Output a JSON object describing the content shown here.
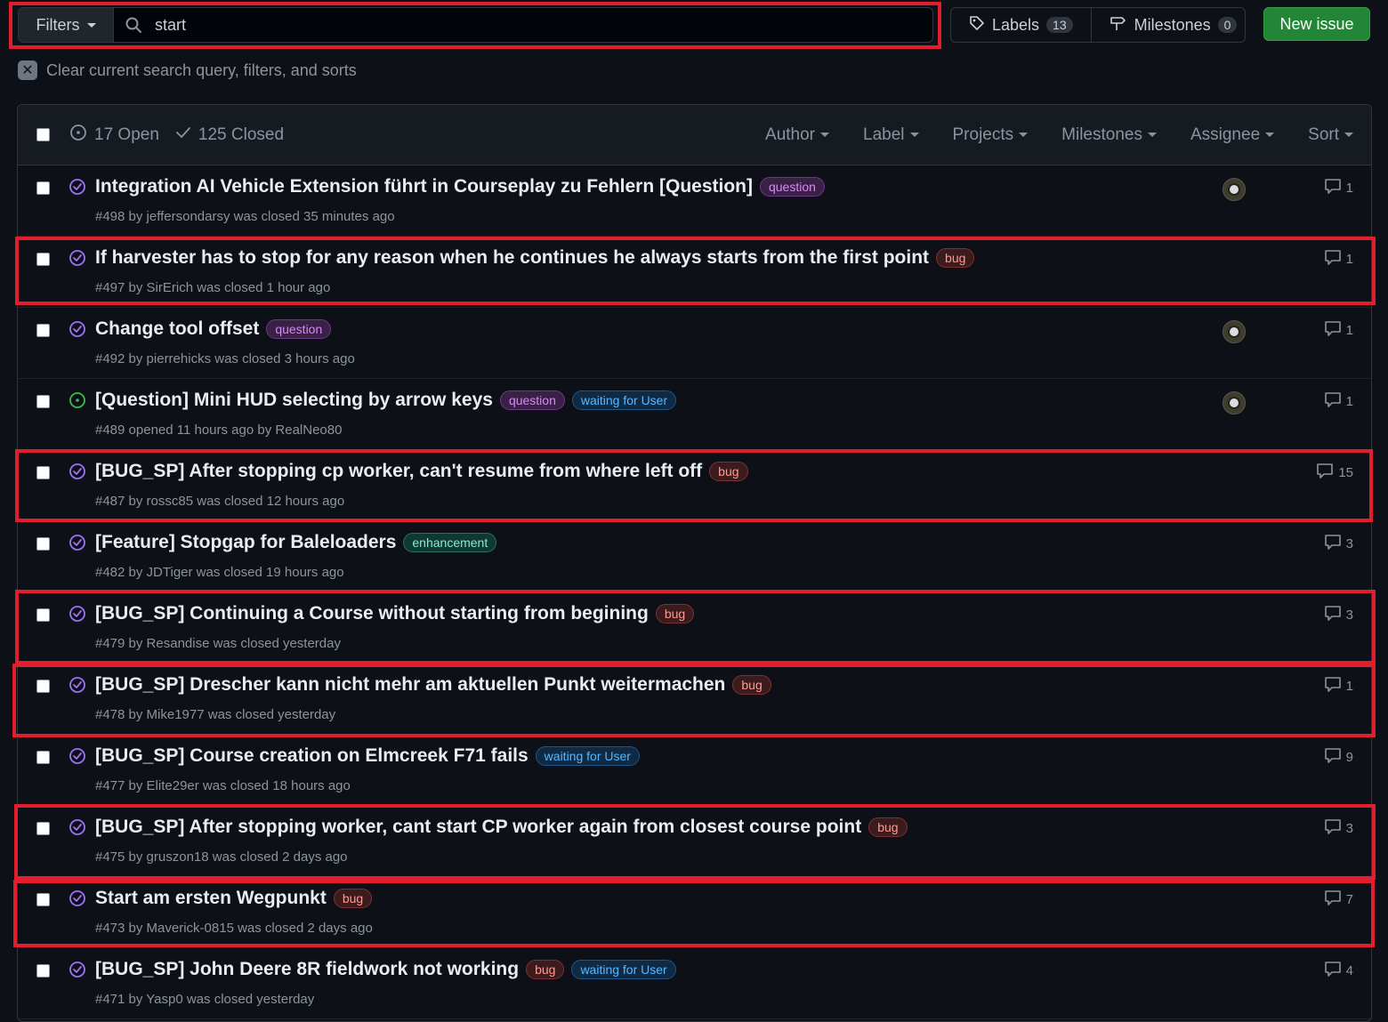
{
  "toolbar": {
    "filters_label": "Filters",
    "search_value": "start",
    "labels_label": "Labels",
    "labels_count": "13",
    "milestones_label": "Milestones",
    "milestones_count": "0",
    "new_issue_label": "New issue"
  },
  "clear_query": "Clear current search query, filters, and sorts",
  "list_header": {
    "open": "17 Open",
    "closed": "125 Closed",
    "menus": [
      "Author",
      "Label",
      "Projects",
      "Milestones",
      "Assignee",
      "Sort"
    ]
  },
  "issues": [
    {
      "title": "Integration AI Vehicle Extension führt in Courseplay zu Fehlern [Question]",
      "labels": [
        "question"
      ],
      "meta": "#498 by jeffersondarsy was closed 35 minutes ago",
      "comments": "1",
      "state": "closed",
      "avatar": true
    },
    {
      "title": "If harvester has to stop for any reason when he continues he always starts from the first point",
      "labels": [
        "bug"
      ],
      "meta": "#497 by SirErich was closed 1 hour ago",
      "comments": "1",
      "state": "closed",
      "avatar": false
    },
    {
      "title": "Change tool offset",
      "labels": [
        "question"
      ],
      "meta": "#492 by pierrehicks was closed 3 hours ago",
      "comments": "1",
      "state": "closed",
      "avatar": true
    },
    {
      "title": "[Question] Mini HUD selecting by arrow keys",
      "labels": [
        "question",
        "waiting for User"
      ],
      "meta": "#489 opened 11 hours ago by RealNeo80",
      "comments": "1",
      "state": "open",
      "avatar": true
    },
    {
      "title": "[BUG_SP] After stopping cp worker, can't resume from where left off",
      "labels": [
        "bug"
      ],
      "meta": "#487 by rossc85 was closed 12 hours ago",
      "comments": "15",
      "state": "closed",
      "avatar": false
    },
    {
      "title": "[Feature] Stopgap for Baleloaders",
      "labels": [
        "enhancement"
      ],
      "meta": "#482 by JDTiger was closed 19 hours ago",
      "comments": "3",
      "state": "closed",
      "avatar": false
    },
    {
      "title": "[BUG_SP] Continuing a Course without starting from begining",
      "labels": [
        "bug"
      ],
      "meta": "#479 by Resandise was closed yesterday",
      "comments": "3",
      "state": "closed",
      "avatar": false
    },
    {
      "title": "[BUG_SP] Drescher kann nicht mehr am aktuellen Punkt weitermachen",
      "labels": [
        "bug"
      ],
      "meta": "#478 by Mike1977 was closed yesterday",
      "comments": "1",
      "state": "closed",
      "avatar": false
    },
    {
      "title": "[BUG_SP] Course creation on Elmcreek F71 fails",
      "labels": [
        "waiting for User"
      ],
      "meta": "#477 by Elite29er was closed 18 hours ago",
      "comments": "9",
      "state": "closed",
      "avatar": false
    },
    {
      "title": "[BUG_SP] After stopping worker, cant start CP worker again from closest course point",
      "labels": [
        "bug"
      ],
      "meta": "#475 by gruszon18 was closed 2 days ago",
      "comments": "3",
      "state": "closed",
      "avatar": false
    },
    {
      "title": "Start am ersten Wegpunkt",
      "labels": [
        "bug"
      ],
      "meta": "#473 by Maverick-0815 was closed 2 days ago",
      "comments": "7",
      "state": "closed",
      "avatar": false
    },
    {
      "title": "[BUG_SP] John Deere 8R fieldwork not working",
      "labels": [
        "bug",
        "waiting for User"
      ],
      "meta": "#471 by Yasp0 was closed yesterday",
      "comments": "4",
      "state": "closed",
      "avatar": false
    }
  ],
  "colors": {
    "highlight": "#e11d2e",
    "closed_icon": "#a371f7",
    "open_icon": "#3fb950",
    "primary_button": "#238636"
  }
}
